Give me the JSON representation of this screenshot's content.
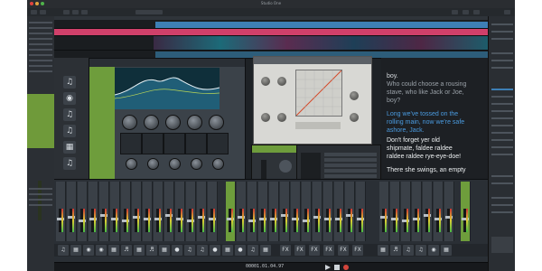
{
  "window": {
    "title": "Studio One"
  },
  "lyrics": {
    "lines_white_1": [
      "boy."
    ],
    "line_muted_1": "Who could choose a rousing",
    "line_muted_2": "stave, who like Jack or Joe,",
    "line_muted_3": "boy?",
    "line_blue_1": "Long we've tossed on the",
    "line_blue_2": "rolling main, now we're safe",
    "line_blue_3": "ashore, Jack.",
    "line_white_2": "Don't forget yer old",
    "line_white_3": "shipmate, faldee raldee",
    "line_white_4": "raldee raldee rye-eye-doe!",
    "line_white_5": "There she swings, an empty"
  },
  "mixer": {
    "fx_labels": [
      "FX",
      "FX",
      "FX",
      "FX",
      "FX",
      "FX"
    ]
  },
  "transport": {
    "timecode": "00001.01.04.97"
  },
  "icons": [
    "guitar-icon",
    "piano-icon",
    "drum-icon",
    "microphone-icon",
    "trumpet-icon",
    "keys-icon"
  ],
  "colors": {
    "accent_green": "#6e9d3c",
    "accent_blue": "#3d7fb5",
    "lyrics_blue": "#4a9be0"
  }
}
